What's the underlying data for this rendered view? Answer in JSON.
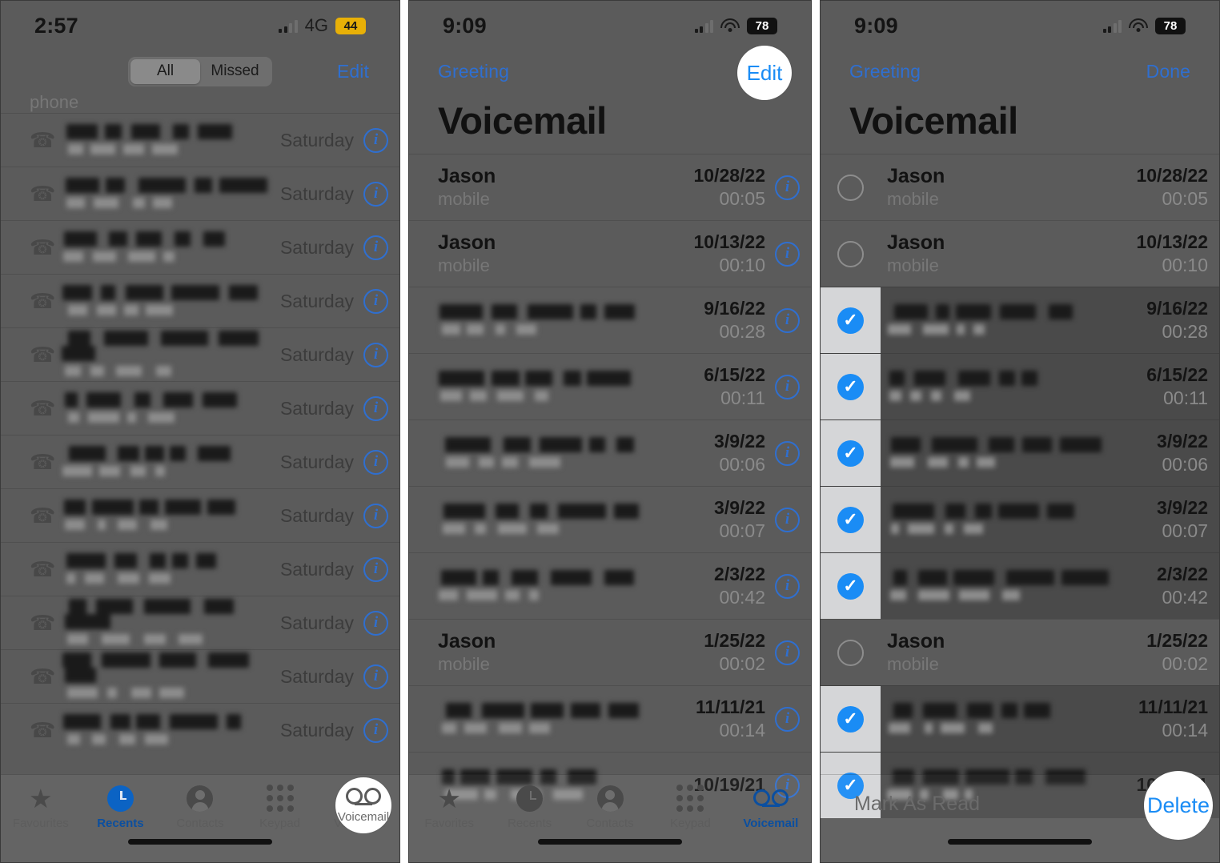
{
  "panels": [
    {
      "id": "recents",
      "status": {
        "time": "2:57",
        "network": "4G",
        "battery": "44",
        "battery_style": "yellow",
        "wifi": false
      },
      "segmented": {
        "options": [
          "All",
          "Missed"
        ],
        "selected": "All"
      },
      "edit_label": "Edit",
      "partial_row_label": "phone",
      "call_rows": [
        {
          "day": "Saturday",
          "redacted": true
        },
        {
          "day": "Saturday",
          "redacted": true
        },
        {
          "day": "Saturday",
          "redacted": true
        },
        {
          "day": "Saturday",
          "redacted": true
        },
        {
          "day": "Saturday",
          "redacted": true
        },
        {
          "day": "Saturday",
          "redacted": true
        },
        {
          "day": "Saturday",
          "redacted": true
        },
        {
          "day": "Saturday",
          "redacted": true
        },
        {
          "day": "Saturday",
          "redacted": true
        },
        {
          "day": "Saturday",
          "redacted": true
        },
        {
          "day": "Saturday",
          "redacted": true
        },
        {
          "day": "Saturday",
          "redacted": true
        }
      ],
      "tabs": [
        {
          "label": "Favourites",
          "icon": "star-icon",
          "active": false
        },
        {
          "label": "Recents",
          "icon": "clock-icon",
          "active": true
        },
        {
          "label": "Contacts",
          "icon": "person-icon",
          "active": false
        },
        {
          "label": "Keypad",
          "icon": "keypad-icon",
          "active": false
        },
        {
          "label": "Voicemail",
          "icon": "voicemail-icon",
          "active": false
        }
      ],
      "spotlight": {
        "target": "voicemail-tab",
        "label": "Voicemail"
      }
    },
    {
      "id": "voicemail-list",
      "status": {
        "time": "9:09",
        "network": "",
        "battery": "78",
        "battery_style": "dark",
        "wifi": true
      },
      "back_label": "Greeting",
      "action_label": "Edit",
      "title": "Voicemail",
      "rows": [
        {
          "name": "Jason",
          "sub": "mobile",
          "date": "10/28/22",
          "duration": "00:05",
          "redacted": false
        },
        {
          "name": "Jason",
          "sub": "mobile",
          "date": "10/13/22",
          "duration": "00:10",
          "redacted": false
        },
        {
          "name": "",
          "sub": "",
          "date": "9/16/22",
          "duration": "00:28",
          "redacted": true
        },
        {
          "name": "",
          "sub": "",
          "date": "6/15/22",
          "duration": "00:11",
          "redacted": true
        },
        {
          "name": "",
          "sub": "",
          "date": "3/9/22",
          "duration": "00:06",
          "redacted": true
        },
        {
          "name": "",
          "sub": "",
          "date": "3/9/22",
          "duration": "00:07",
          "redacted": true
        },
        {
          "name": "",
          "sub": "",
          "date": "2/3/22",
          "duration": "00:42",
          "redacted": true
        },
        {
          "name": "Jason",
          "sub": "mobile",
          "date": "1/25/22",
          "duration": "00:02",
          "redacted": false
        },
        {
          "name": "",
          "sub": "",
          "date": "11/11/21",
          "duration": "00:14",
          "redacted": true
        },
        {
          "name": "",
          "sub": "",
          "date": "10/19/21",
          "duration": "",
          "redacted": true
        }
      ],
      "tabs": [
        {
          "label": "Favorites",
          "icon": "star-icon",
          "active": false
        },
        {
          "label": "Recents",
          "icon": "clock-icon",
          "active": false
        },
        {
          "label": "Contacts",
          "icon": "person-icon",
          "active": false
        },
        {
          "label": "Keypad",
          "icon": "keypad-icon",
          "active": false
        },
        {
          "label": "Voicemail",
          "icon": "voicemail-icon",
          "active": true
        }
      ],
      "spotlight": {
        "target": "edit-button",
        "label": "Edit"
      }
    },
    {
      "id": "voicemail-edit",
      "status": {
        "time": "9:09",
        "network": "",
        "battery": "78",
        "battery_style": "dark",
        "wifi": true
      },
      "back_label": "Greeting",
      "action_label": "Done",
      "title": "Voicemail",
      "rows": [
        {
          "name": "Jason",
          "sub": "mobile",
          "date": "10/28/22",
          "duration": "00:05",
          "redacted": false,
          "selected": false
        },
        {
          "name": "Jason",
          "sub": "mobile",
          "date": "10/13/22",
          "duration": "00:10",
          "redacted": false,
          "selected": false
        },
        {
          "name": "",
          "sub": "",
          "date": "9/16/22",
          "duration": "00:28",
          "redacted": true,
          "selected": true
        },
        {
          "name": "",
          "sub": "",
          "date": "6/15/22",
          "duration": "00:11",
          "redacted": true,
          "selected": true
        },
        {
          "name": "",
          "sub": "",
          "date": "3/9/22",
          "duration": "00:06",
          "redacted": true,
          "selected": true
        },
        {
          "name": "",
          "sub": "",
          "date": "3/9/22",
          "duration": "00:07",
          "redacted": true,
          "selected": true
        },
        {
          "name": "",
          "sub": "",
          "date": "2/3/22",
          "duration": "00:42",
          "redacted": true,
          "selected": true
        },
        {
          "name": "Jason",
          "sub": "mobile",
          "date": "1/25/22",
          "duration": "00:02",
          "redacted": false,
          "selected": false
        },
        {
          "name": "",
          "sub": "",
          "date": "11/11/21",
          "duration": "00:14",
          "redacted": true,
          "selected": true
        },
        {
          "name": "",
          "sub": "",
          "date": "10/19/21",
          "duration": "",
          "redacted": true,
          "selected": true
        }
      ],
      "mark_as_read_label": "Mark As Read",
      "delete_label": "Delete",
      "spotlight": {
        "target": "delete-button",
        "label": "Delete"
      }
    }
  ],
  "colors": {
    "accent_blue": "#1a8cf5",
    "link_blue": "#2f6fd0",
    "tab_active": "#0b4fa0",
    "battery_yellow": "#e8b007",
    "selection_strip": "#d5d6d8",
    "selected_row": "#4a4a4a",
    "dim_overlay": "#5b5b5b"
  },
  "checkmark_glyph": "✓"
}
